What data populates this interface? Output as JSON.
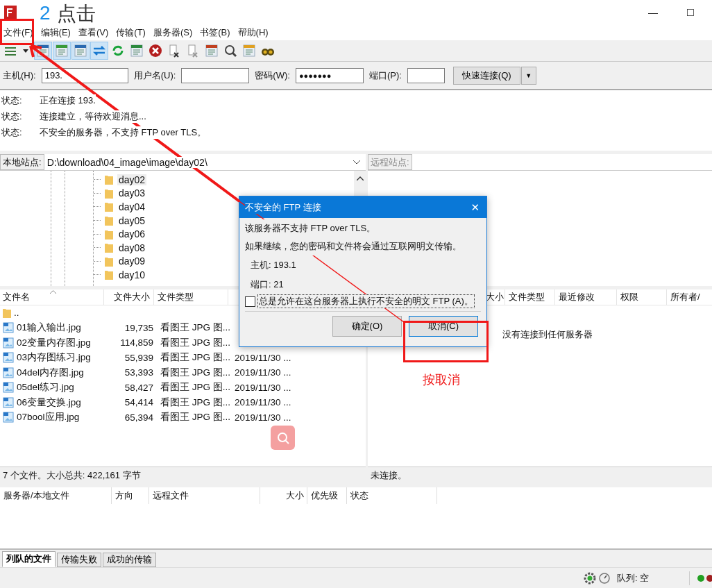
{
  "window": {
    "controls": [
      "—",
      "☐"
    ]
  },
  "menu": [
    "文件(F)",
    "编辑(E)",
    "查看(V)",
    "传输(T)",
    "服务器(S)",
    "书签(B)",
    "帮助(H)"
  ],
  "toolbar": [
    {
      "kind": "sites",
      "on": false
    },
    {
      "kind": "log",
      "on": true
    },
    {
      "kind": "local",
      "on": true
    },
    {
      "kind": "remote",
      "on": true
    },
    {
      "kind": "queue",
      "on": true
    },
    {
      "kind": "refresh",
      "on": false
    },
    {
      "kind": "process",
      "on": false
    },
    {
      "kind": "stop",
      "on": false
    },
    {
      "kind": "disconnect",
      "on": false
    },
    {
      "kind": "reconnect",
      "on": false
    },
    {
      "kind": "filter",
      "on": false
    },
    {
      "kind": "compare",
      "on": false
    },
    {
      "kind": "sync",
      "on": false
    },
    {
      "kind": "find",
      "on": false
    }
  ],
  "quickconnect": {
    "host_label": "主机(H):",
    "host": "193.",
    "user_label": "用户名(U):",
    "password_label": "密码(W):",
    "password": "●●●●●●●",
    "port_label": "端口(P):",
    "button": "快速连接(Q)",
    "caret": "▼"
  },
  "log": [
    {
      "label": "状态:",
      "text": "正在连接 193."
    },
    {
      "label": "状态:",
      "text": "连接建立，等待欢迎消息..."
    },
    {
      "label": "状态:",
      "text": "不安全的服务器，不支持 FTP over TLS。"
    }
  ],
  "local_site": {
    "label": "本地站点:",
    "path": "D:\\download\\04_image\\image\\day02\\"
  },
  "remote_site": {
    "label": "远程站点:",
    "disabled": true
  },
  "tree": [
    {
      "label": "day02",
      "selected": true
    },
    {
      "label": "day03",
      "selected": false
    },
    {
      "label": "day04",
      "selected": false
    },
    {
      "label": "day05",
      "selected": false
    },
    {
      "label": "day06",
      "selected": false
    },
    {
      "label": "day08",
      "selected": false
    },
    {
      "label": "day09",
      "selected": false
    },
    {
      "label": "day10",
      "selected": false
    }
  ],
  "local_columns": [
    "文件名",
    "文件大小",
    "文件类型"
  ],
  "local_files": [
    {
      "kind": "folder",
      "name": ".."
    },
    {
      "kind": "image",
      "name": "01输入输出.jpg",
      "size": "19,735",
      "type": "看图王 JPG 图..."
    },
    {
      "kind": "image",
      "name": "02变量内存图.jpg",
      "size": "114,859",
      "type": "看图王 JPG 图..."
    },
    {
      "kind": "image",
      "name": "03内存图练习.jpg",
      "size": "55,939",
      "type": "看图王 JPG 图...",
      "date": "2019/11/30 ..."
    },
    {
      "kind": "image",
      "name": "04del内存图.jpg",
      "size": "53,393",
      "type": "看图王 JPG 图...",
      "date": "2019/11/30 ..."
    },
    {
      "kind": "image",
      "name": "05del练习.jpg",
      "size": "58,427",
      "type": "看图王 JPG 图...",
      "date": "2019/11/30 ..."
    },
    {
      "kind": "image",
      "name": "06变量交换.jpg",
      "size": "54,414",
      "type": "看图王 JPG 图...",
      "date": "2019/11/30 ..."
    },
    {
      "kind": "image",
      "name": "07bool应用.jpg",
      "size": "65,394",
      "type": "看图王 JPG 图...",
      "date": "2019/11/30 ..."
    }
  ],
  "remote_columns": [
    "大小",
    "文件类型",
    "最近修改",
    "权限",
    "所有者/"
  ],
  "remote_message": "没有连接到任何服务器",
  "local_status": "7 个文件。大小总共: 422,161 字节",
  "remote_status": "未连接。",
  "queue_columns": [
    "服务器/本地文件",
    "方向",
    "远程文件",
    "大小",
    "优先级",
    "状态"
  ],
  "queue_tabs": [
    {
      "label": "列队的文件",
      "selected": true
    },
    {
      "label": "传输失败",
      "selected": false
    },
    {
      "label": "成功的传输",
      "selected": false
    }
  ],
  "status_bar": {
    "queue": "队列: 空"
  },
  "dialog": {
    "title": "不安全的 FTP 连接",
    "close": "✕",
    "line1": "该服务器不支持 FTP over TLS。",
    "line2": "如果继续，您的密码和文件将会通过互联网明文传输。",
    "host": "主机: 193.1",
    "port": "端口: 21",
    "checkbox": {
      "label": "总是允许在这台服务器上执行不安全的明文 FTP (A)。",
      "checked": false
    },
    "buttons": [
      "确定(O)",
      "取消(C)"
    ]
  },
  "annotations": {
    "step_number": "2",
    "step_text": "点击",
    "cancel_note": "按取消"
  }
}
